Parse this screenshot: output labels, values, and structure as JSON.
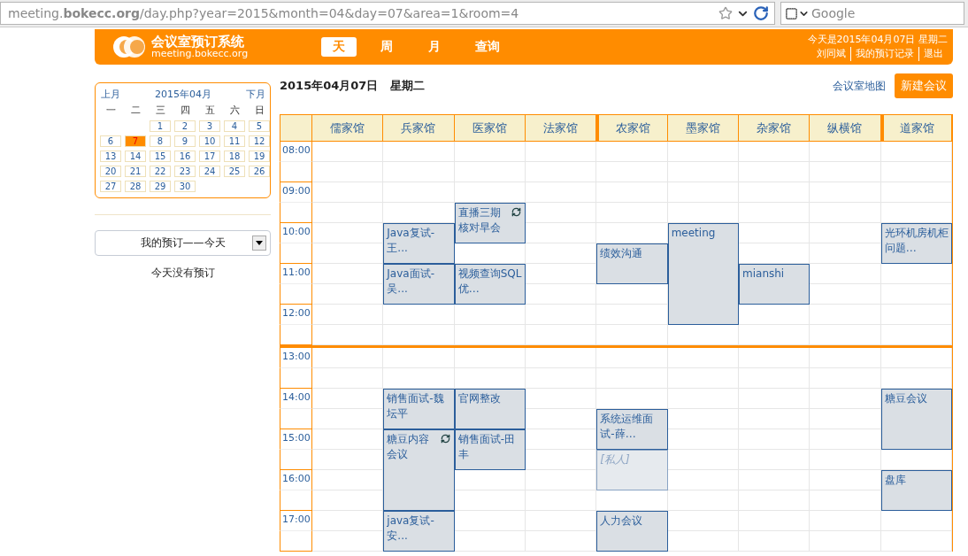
{
  "browser": {
    "url": "meeting.**bokecc.org**/day.php?year=2015&month=04&day=07&area=1&room=4",
    "search_placeholder": "Google"
  },
  "header": {
    "logo_title": "会议室预订系统",
    "logo_subtitle": "meeting.bokecc.org",
    "nav": [
      {
        "label": "天",
        "selected": true
      },
      {
        "label": "周",
        "selected": false
      },
      {
        "label": "月",
        "selected": false
      },
      {
        "label": "查询",
        "selected": false
      }
    ],
    "today": "今天是2015年04月07日 星期二",
    "links": [
      "刘同斌",
      "我的预订记录",
      "退出"
    ]
  },
  "sidebar": {
    "calendar": {
      "prev": "上月",
      "title": "2015年04月",
      "next": "下月",
      "weekdays": [
        "一",
        "二",
        "三",
        "四",
        "五",
        "六",
        "日"
      ],
      "weeks": [
        [
          {
            "kind": "blank"
          },
          {
            "kind": "blank"
          },
          {
            "kind": "day",
            "label": "1",
            "selected": false
          },
          {
            "kind": "day",
            "label": "2",
            "selected": false
          },
          {
            "kind": "day",
            "label": "3",
            "selected": false
          },
          {
            "kind": "day",
            "label": "4",
            "selected": false
          },
          {
            "kind": "day",
            "label": "5",
            "selected": false
          }
        ],
        [
          {
            "kind": "day",
            "label": "6",
            "selected": false
          },
          {
            "kind": "day",
            "label": "7",
            "selected": true
          },
          {
            "kind": "day",
            "label": "8",
            "selected": false
          },
          {
            "kind": "day",
            "label": "9",
            "selected": false
          },
          {
            "kind": "day",
            "label": "10",
            "selected": false
          },
          {
            "kind": "day",
            "label": "11",
            "selected": false
          },
          {
            "kind": "day",
            "label": "12",
            "selected": false
          }
        ],
        [
          {
            "kind": "day",
            "label": "13",
            "selected": false
          },
          {
            "kind": "day",
            "label": "14",
            "selected": false
          },
          {
            "kind": "day",
            "label": "15",
            "selected": false
          },
          {
            "kind": "day",
            "label": "16",
            "selected": false
          },
          {
            "kind": "day",
            "label": "17",
            "selected": false
          },
          {
            "kind": "day",
            "label": "18",
            "selected": false
          },
          {
            "kind": "day",
            "label": "19",
            "selected": false
          }
        ],
        [
          {
            "kind": "day",
            "label": "20",
            "selected": false
          },
          {
            "kind": "day",
            "label": "21",
            "selected": false
          },
          {
            "kind": "day",
            "label": "22",
            "selected": false
          },
          {
            "kind": "day",
            "label": "23",
            "selected": false
          },
          {
            "kind": "day",
            "label": "24",
            "selected": false
          },
          {
            "kind": "day",
            "label": "25",
            "selected": false
          },
          {
            "kind": "day",
            "label": "26",
            "selected": false
          }
        ],
        [
          {
            "kind": "day",
            "label": "27",
            "selected": false
          },
          {
            "kind": "day",
            "label": "28",
            "selected": false
          },
          {
            "kind": "day",
            "label": "29",
            "selected": false
          },
          {
            "kind": "day",
            "label": "30",
            "selected": false
          }
        ]
      ]
    },
    "my_bookings_select": "我的预订——今天",
    "empty_message": "今天没有预订"
  },
  "main": {
    "date": "2015年04月07日",
    "weekday": "星期二",
    "map_link": "会议室地图",
    "new_button": "新建会议"
  },
  "schedule": {
    "rooms": [
      "儒家馆",
      "兵家馆",
      "医家馆",
      "法家馆",
      "农家馆",
      "墨家馆",
      "杂家馆",
      "纵横馆",
      "道家馆"
    ],
    "rows": [
      {
        "kind": "slot",
        "time": "08:00",
        "cells": [
          {
            "kind": "empty"
          },
          {
            "kind": "empty"
          },
          {
            "kind": "empty"
          },
          {
            "kind": "empty"
          },
          {
            "kind": "empty"
          },
          {
            "kind": "empty"
          },
          {
            "kind": "empty"
          },
          {
            "kind": "empty"
          },
          {
            "kind": "empty"
          }
        ]
      },
      {
        "kind": "slot",
        "cells": [
          {
            "kind": "empty"
          },
          {
            "kind": "empty"
          },
          {
            "kind": "empty"
          },
          {
            "kind": "empty"
          },
          {
            "kind": "empty"
          },
          {
            "kind": "empty"
          },
          {
            "kind": "empty"
          },
          {
            "kind": "empty"
          },
          {
            "kind": "empty"
          }
        ]
      },
      {
        "kind": "slot",
        "time": "09:00",
        "cells": [
          {
            "kind": "empty"
          },
          {
            "kind": "empty"
          },
          {
            "kind": "empty"
          },
          {
            "kind": "empty"
          },
          {
            "kind": "empty"
          },
          {
            "kind": "empty"
          },
          {
            "kind": "empty"
          },
          {
            "kind": "empty"
          },
          {
            "kind": "empty"
          }
        ]
      },
      {
        "kind": "slot",
        "cells": [
          {
            "kind": "empty"
          },
          {
            "kind": "empty"
          },
          {
            "kind": "booking",
            "title": "直播三期核对早会",
            "repeat": true,
            "private": false
          },
          {
            "kind": "empty"
          },
          {
            "kind": "empty"
          },
          {
            "kind": "empty"
          },
          {
            "kind": "empty"
          },
          {
            "kind": "empty"
          },
          {
            "kind": "empty"
          }
        ]
      },
      {
        "kind": "slot",
        "time": "10:00",
        "cells": [
          {
            "kind": "empty"
          },
          {
            "kind": "booking",
            "title": "Java复试-王...",
            "repeat": false,
            "private": false
          },
          {
            "kind": "covered"
          },
          {
            "kind": "empty"
          },
          {
            "kind": "empty"
          },
          {
            "kind": "booking",
            "title": "meeting",
            "repeat": false,
            "private": false
          },
          {
            "kind": "empty"
          },
          {
            "kind": "empty"
          },
          {
            "kind": "booking",
            "title": "光环机房机柜问题…",
            "repeat": false,
            "private": false
          }
        ]
      },
      {
        "kind": "slot",
        "cells": [
          {
            "kind": "empty"
          },
          {
            "kind": "covered"
          },
          {
            "kind": "empty"
          },
          {
            "kind": "empty"
          },
          {
            "kind": "booking",
            "title": "绩效沟通",
            "repeat": false,
            "private": false
          },
          {
            "kind": "covered"
          },
          {
            "kind": "empty"
          },
          {
            "kind": "empty"
          },
          {
            "kind": "covered"
          }
        ]
      },
      {
        "kind": "slot",
        "time": "11:00",
        "cells": [
          {
            "kind": "empty"
          },
          {
            "kind": "booking",
            "title": "Java面试-吴...",
            "repeat": false,
            "private": false
          },
          {
            "kind": "booking",
            "title": "视频查询SQL优…",
            "repeat": false,
            "private": false
          },
          {
            "kind": "empty"
          },
          {
            "kind": "covered"
          },
          {
            "kind": "covered"
          },
          {
            "kind": "booking",
            "title": "mianshi",
            "repeat": false,
            "private": false
          },
          {
            "kind": "empty"
          },
          {
            "kind": "empty"
          }
        ]
      },
      {
        "kind": "slot",
        "cells": [
          {
            "kind": "empty"
          },
          {
            "kind": "covered"
          },
          {
            "kind": "covered"
          },
          {
            "kind": "empty"
          },
          {
            "kind": "empty"
          },
          {
            "kind": "covered"
          },
          {
            "kind": "covered"
          },
          {
            "kind": "empty"
          },
          {
            "kind": "empty"
          }
        ]
      },
      {
        "kind": "slot",
        "time": "12:00",
        "cells": [
          {
            "kind": "empty"
          },
          {
            "kind": "empty"
          },
          {
            "kind": "empty"
          },
          {
            "kind": "empty"
          },
          {
            "kind": "empty"
          },
          {
            "kind": "covered"
          },
          {
            "kind": "empty"
          },
          {
            "kind": "empty"
          },
          {
            "kind": "empty"
          }
        ]
      },
      {
        "kind": "slot",
        "cells": [
          {
            "kind": "empty"
          },
          {
            "kind": "empty"
          },
          {
            "kind": "empty"
          },
          {
            "kind": "empty"
          },
          {
            "kind": "empty"
          },
          {
            "kind": "empty"
          },
          {
            "kind": "empty"
          },
          {
            "kind": "empty"
          },
          {
            "kind": "empty"
          }
        ]
      },
      {
        "kind": "break"
      },
      {
        "kind": "slot",
        "time": "13:00",
        "cells": [
          {
            "kind": "empty"
          },
          {
            "kind": "empty"
          },
          {
            "kind": "empty"
          },
          {
            "kind": "empty"
          },
          {
            "kind": "empty"
          },
          {
            "kind": "empty"
          },
          {
            "kind": "empty"
          },
          {
            "kind": "empty"
          },
          {
            "kind": "empty"
          }
        ]
      },
      {
        "kind": "slot",
        "cells": [
          {
            "kind": "empty"
          },
          {
            "kind": "empty"
          },
          {
            "kind": "empty"
          },
          {
            "kind": "empty"
          },
          {
            "kind": "empty"
          },
          {
            "kind": "empty"
          },
          {
            "kind": "empty"
          },
          {
            "kind": "empty"
          },
          {
            "kind": "empty"
          }
        ]
      },
      {
        "kind": "slot",
        "time": "14:00",
        "cells": [
          {
            "kind": "empty"
          },
          {
            "kind": "booking",
            "title": "销售面试-魏坛平",
            "repeat": false,
            "private": false
          },
          {
            "kind": "booking",
            "title": "官网整改",
            "repeat": false,
            "private": false
          },
          {
            "kind": "empty"
          },
          {
            "kind": "empty"
          },
          {
            "kind": "empty"
          },
          {
            "kind": "empty"
          },
          {
            "kind": "empty"
          },
          {
            "kind": "booking",
            "title": "糖豆会议",
            "repeat": false,
            "private": false
          }
        ]
      },
      {
        "kind": "slot",
        "cells": [
          {
            "kind": "empty"
          },
          {
            "kind": "covered"
          },
          {
            "kind": "covered"
          },
          {
            "kind": "empty"
          },
          {
            "kind": "booking",
            "title": "系统运维面试-薛…",
            "repeat": false,
            "private": false
          },
          {
            "kind": "empty"
          },
          {
            "kind": "empty"
          },
          {
            "kind": "empty"
          },
          {
            "kind": "covered"
          }
        ]
      },
      {
        "kind": "slot",
        "time": "15:00",
        "cells": [
          {
            "kind": "empty"
          },
          {
            "kind": "booking",
            "title": "糖豆内容会议",
            "repeat": true,
            "private": false
          },
          {
            "kind": "booking",
            "title": "销售面试-田丰",
            "repeat": false,
            "private": false
          },
          {
            "kind": "empty"
          },
          {
            "kind": "covered"
          },
          {
            "kind": "empty"
          },
          {
            "kind": "empty"
          },
          {
            "kind": "empty"
          },
          {
            "kind": "covered"
          }
        ]
      },
      {
        "kind": "slot",
        "cells": [
          {
            "kind": "empty"
          },
          {
            "kind": "covered"
          },
          {
            "kind": "covered"
          },
          {
            "kind": "empty"
          },
          {
            "kind": "booking",
            "title": "[私人]",
            "repeat": false,
            "private": true
          },
          {
            "kind": "empty"
          },
          {
            "kind": "empty"
          },
          {
            "kind": "empty"
          },
          {
            "kind": "empty"
          }
        ]
      },
      {
        "kind": "slot",
        "time": "16:00",
        "cells": [
          {
            "kind": "empty"
          },
          {
            "kind": "covered"
          },
          {
            "kind": "empty"
          },
          {
            "kind": "empty"
          },
          {
            "kind": "covered"
          },
          {
            "kind": "empty"
          },
          {
            "kind": "empty"
          },
          {
            "kind": "empty"
          },
          {
            "kind": "booking",
            "title": "盘库",
            "repeat": false,
            "private": false
          }
        ]
      },
      {
        "kind": "slot",
        "cells": [
          {
            "kind": "empty"
          },
          {
            "kind": "covered"
          },
          {
            "kind": "empty"
          },
          {
            "kind": "empty"
          },
          {
            "kind": "empty"
          },
          {
            "kind": "empty"
          },
          {
            "kind": "empty"
          },
          {
            "kind": "empty"
          },
          {
            "kind": "covered"
          }
        ]
      },
      {
        "kind": "slot",
        "time": "17:00",
        "cells": [
          {
            "kind": "empty"
          },
          {
            "kind": "booking",
            "title": "java复试-安...",
            "repeat": false,
            "private": false
          },
          {
            "kind": "empty"
          },
          {
            "kind": "empty"
          },
          {
            "kind": "booking",
            "title": "人力会议",
            "repeat": false,
            "private": false
          },
          {
            "kind": "empty"
          },
          {
            "kind": "empty"
          },
          {
            "kind": "empty"
          },
          {
            "kind": "empty"
          }
        ]
      },
      {
        "kind": "slot",
        "cells": [
          {
            "kind": "empty"
          },
          {
            "kind": "covered"
          },
          {
            "kind": "empty"
          },
          {
            "kind": "empty"
          },
          {
            "kind": "covered"
          },
          {
            "kind": "empty"
          },
          {
            "kind": "empty"
          },
          {
            "kind": "empty"
          },
          {
            "kind": "empty"
          }
        ]
      }
    ]
  }
}
